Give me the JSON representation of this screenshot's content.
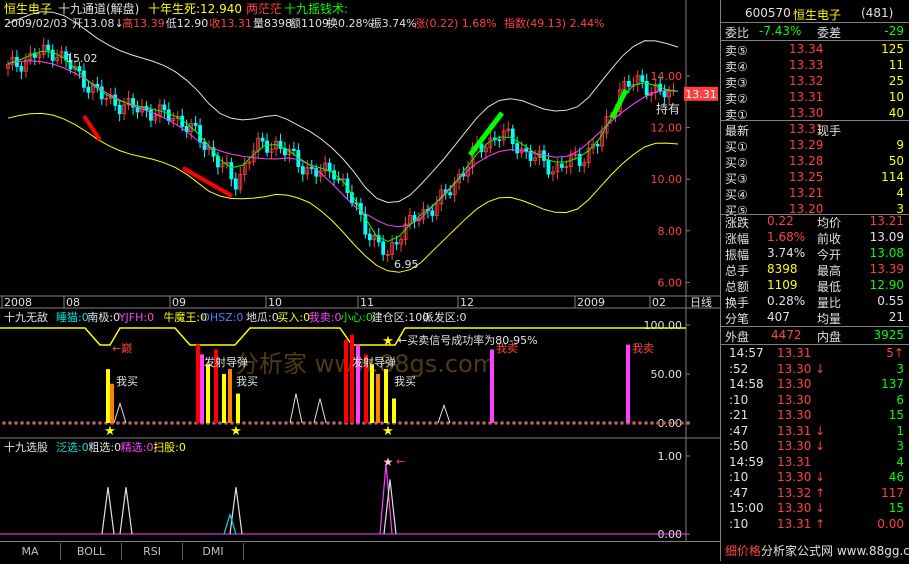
{
  "header": {
    "stock_name": "恒生电子",
    "indicator": "十九通道(解盘)",
    "ind_items": [
      {
        "label": "十年生死:",
        "value": "12.940",
        "color": "#ffff00"
      },
      {
        "label": "两茫茫",
        "value": "",
        "color": "#ff4040"
      },
      {
        "label": "十九摇钱术:",
        "value": "",
        "color": "#00ff00"
      }
    ],
    "date": "2009/02/03",
    "ohlc": [
      {
        "label": "开",
        "value": "13.08",
        "arrow": "↓",
        "color": "#e0e0e0"
      },
      {
        "label": "高",
        "value": "13.39",
        "color": "#ff4040"
      },
      {
        "label": "低",
        "value": "12.90",
        "color": "#e0e0e0"
      },
      {
        "label": "收",
        "value": "13.31",
        "color": "#ff4040"
      },
      {
        "label": "量",
        "value": "8398",
        "color": "#e0e0e0"
      },
      {
        "label": "额",
        "value": "1109",
        "color": "#e0e0e0"
      },
      {
        "label": "换",
        "value": "0.28%",
        "color": "#e0e0e0"
      },
      {
        "label": "振",
        "value": "3.74%",
        "color": "#e0e0e0"
      },
      {
        "label": "涨",
        "value": "(0.22)",
        "extra": "1.68%",
        "color": "#ff4040"
      },
      {
        "label": "指数",
        "value": "(49.13)",
        "extra": "2.44%",
        "color": "#ff4040"
      }
    ]
  },
  "main_chart": {
    "y_labels": [
      "14.00",
      "12.00",
      "10.00",
      "8.00",
      "6.00"
    ],
    "current_price": "13.31",
    "hold_label": "持有",
    "high_annot": "15.02",
    "low_annot": "6.95",
    "x_labels": [
      "2008",
      "08",
      "09",
      "10",
      "11",
      "12",
      "2009",
      "02"
    ],
    "x_unit": "日线"
  },
  "panel1": {
    "title": "十九无敌",
    "items": [
      {
        "label": "睡猫:",
        "value": "0",
        "color": "#00e0e0"
      },
      {
        "label": "南极:",
        "value": "0",
        "color": "#e0e0e0"
      },
      {
        "label": "YJFH:",
        "value": "0",
        "color": "#ff40ff"
      },
      {
        "label": "牛魔王:",
        "value": "0",
        "color": "#ffff00"
      },
      {
        "label": "DHSZ:",
        "value": "0",
        "color": "#4080ff"
      },
      {
        "label": "地瓜:",
        "value": "0",
        "color": "#e0e0e0"
      },
      {
        "label": "买入:",
        "value": "0",
        "color": "#ffff00"
      },
      {
        "label": "我卖:",
        "value": "0",
        "color": "#ff40ff"
      },
      {
        "label": "小心:",
        "value": "0",
        "color": "#00ff00"
      },
      {
        "label": "建仓区:",
        "value": "100",
        "color": "#e0e0e0"
      },
      {
        "label": "派发区:",
        "value": "0",
        "color": "#e0e0e0"
      }
    ],
    "y_labels": [
      "100.00",
      "50.00",
      "0.00"
    ],
    "annots": {
      "peak": "←巅",
      "buy": "我买",
      "launch": "发射导弹",
      "sell": "我卖",
      "signal": "←买卖信号成功率为80-95%",
      "arrow_left": "←"
    },
    "watermark": "分析家 www.88gs.com"
  },
  "panel2": {
    "title": "十九选股",
    "items": [
      {
        "label": "泛选:",
        "value": "0",
        "color": "#00e0e0"
      },
      {
        "label": "粗选:",
        "value": "0",
        "color": "#e0e0e0"
      },
      {
        "label": "精选:",
        "value": "0",
        "color": "#ff40ff"
      },
      {
        "label": "扫股:",
        "value": "0",
        "color": "#ffff00"
      }
    ],
    "y_labels": [
      "1.00",
      "0.00"
    ],
    "arrow": "←"
  },
  "tabs": [
    "MA",
    "BOLL",
    "RSI",
    "DMI"
  ],
  "right_panel": {
    "code": "600570",
    "name": "恒生电子",
    "count": "(481)",
    "weibi_label": "委比",
    "weibi": "-7.43%",
    "weicha_label": "委差",
    "weicha": "-29",
    "sells": [
      {
        "label": "卖⑤",
        "price": "13.34",
        "vol": "125"
      },
      {
        "label": "卖④",
        "price": "13.33",
        "vol": "11"
      },
      {
        "label": "卖③",
        "price": "13.32",
        "vol": "25"
      },
      {
        "label": "卖②",
        "price": "13.31",
        "vol": "10"
      },
      {
        "label": "卖①",
        "price": "13.30",
        "vol": "40"
      }
    ],
    "latest_label": "最新",
    "latest": "13.31",
    "xianshou_label": "现手",
    "buys": [
      {
        "label": "买①",
        "price": "13.29",
        "vol": "9"
      },
      {
        "label": "买②",
        "price": "13.28",
        "vol": "50"
      },
      {
        "label": "买③",
        "price": "13.25",
        "vol": "114"
      },
      {
        "label": "买④",
        "price": "13.21",
        "vol": "4"
      },
      {
        "label": "买⑤",
        "price": "13.20",
        "vol": "3"
      }
    ],
    "stats": [
      {
        "l1": "涨跌",
        "v1": "0.22",
        "c1": "#ff4040",
        "l2": "均价",
        "v2": "13.21",
        "c2": "#ff4040"
      },
      {
        "l1": "涨幅",
        "v1": "1.68%",
        "c1": "#ff4040",
        "l2": "前收",
        "v2": "13.09",
        "c2": "#e0e0e0"
      },
      {
        "l1": "振幅",
        "v1": "3.74%",
        "c1": "#e0e0e0",
        "l2": "今开",
        "v2": "13.08",
        "c2": "#00ff00"
      },
      {
        "l1": "总手",
        "v1": "8398",
        "c1": "#ffff00",
        "l2": "最高",
        "v2": "13.39",
        "c2": "#ff4040"
      },
      {
        "l1": "总额",
        "v1": "1109",
        "c1": "#ffff00",
        "l2": "最低",
        "v2": "12.90",
        "c2": "#00ff00"
      },
      {
        "l1": "换手",
        "v1": "0.28%",
        "c1": "#e0e0e0",
        "l2": "量比",
        "v2": "0.55",
        "c2": "#e0e0e0"
      },
      {
        "l1": "分笔",
        "v1": "407",
        "c1": "#e0e0e0",
        "l2": "均量",
        "v2": "21",
        "c2": "#e0e0e0"
      }
    ],
    "waipan_label": "外盘",
    "waipan": "4472",
    "neipan_label": "内盘",
    "neipan": "3925",
    "ticks": [
      {
        "t": "14:57",
        "p": "13.31",
        "a": "",
        "v": "5",
        "pc": "#ff4040",
        "vc": "#ff4040",
        "va": "↑"
      },
      {
        "t": ":52",
        "p": "13.30",
        "a": "↓",
        "v": "3",
        "pc": "#ff4040",
        "vc": "#00ff00",
        "va": ""
      },
      {
        "t": "14:58",
        "p": "13.30",
        "a": "",
        "v": "137",
        "pc": "#ff4040",
        "vc": "#00ff00",
        "va": ""
      },
      {
        "t": ":10",
        "p": "13.30",
        "a": "",
        "v": "6",
        "pc": "#ff4040",
        "vc": "#00ff00",
        "va": ""
      },
      {
        "t": ":21",
        "p": "13.30",
        "a": "",
        "v": "15",
        "pc": "#ff4040",
        "vc": "#00ff00",
        "va": ""
      },
      {
        "t": ":47",
        "p": "13.31",
        "a": "↓",
        "v": "1",
        "pc": "#ff4040",
        "vc": "#00ff00",
        "va": ""
      },
      {
        "t": ":50",
        "p": "13.30",
        "a": "↓",
        "v": "3",
        "pc": "#ff4040",
        "vc": "#00ff00",
        "va": ""
      },
      {
        "t": "14:59",
        "p": "13.31",
        "a": "",
        "v": "4",
        "pc": "#ff4040",
        "vc": "#00ff00",
        "va": ""
      },
      {
        "t": ":10",
        "p": "13.30",
        "a": "↓",
        "v": "46",
        "pc": "#ff4040",
        "vc": "#00ff00",
        "va": ""
      },
      {
        "t": ":47",
        "p": "13.32",
        "a": "↑",
        "v": "117",
        "pc": "#ff4040",
        "vc": "#ff4040",
        "va": ""
      },
      {
        "t": "15:00",
        "p": "13.30",
        "a": "↓",
        "v": "15",
        "pc": "#ff4040",
        "vc": "#00ff00",
        "va": ""
      },
      {
        "t": ":10",
        "p": "13.31",
        "a": "↑",
        "v": "0.00",
        "pc": "#ff4040",
        "vc": "#ff4040",
        "va": ""
      }
    ],
    "bottom_label": "细价格",
    "site": "分析家公式网 www.88gg.com"
  },
  "colors": {
    "up": "#ff4040",
    "down": "#00ffff",
    "grid": "#808080",
    "bg": "#000000"
  }
}
